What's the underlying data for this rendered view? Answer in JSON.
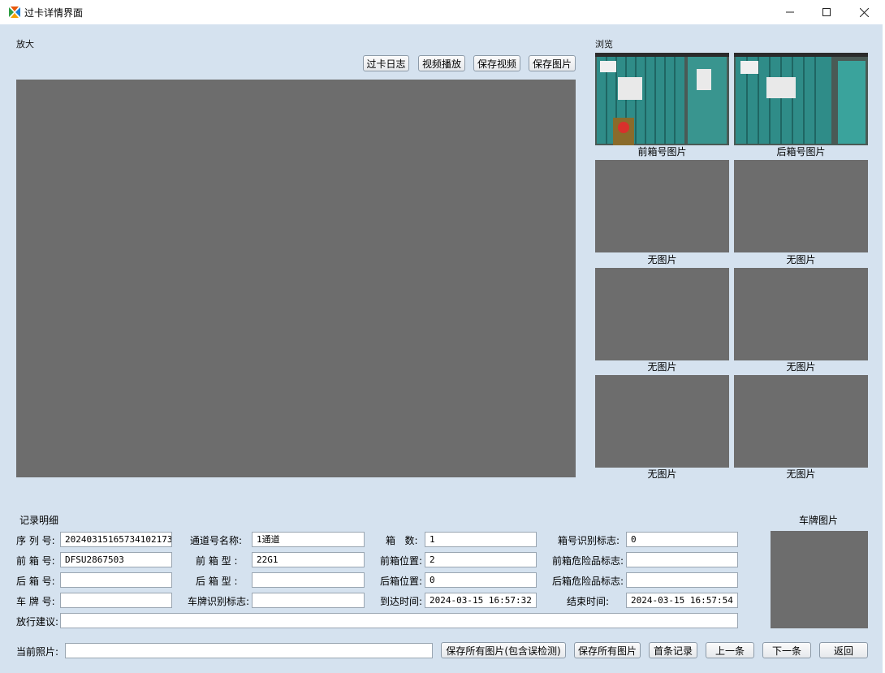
{
  "window": {
    "title": "过卡详情界面"
  },
  "zoom_section": {
    "label": "放大"
  },
  "browse_section": {
    "label": "浏览"
  },
  "toolbar": {
    "log_label": "过卡日志",
    "play_label": "视频播放",
    "save_video_label": "保存视频",
    "save_image_label": "保存图片"
  },
  "thumbnails": [
    {
      "caption": "前箱号图片"
    },
    {
      "caption": "后箱号图片"
    },
    {
      "caption": "无图片"
    },
    {
      "caption": "无图片"
    },
    {
      "caption": "无图片"
    },
    {
      "caption": "无图片"
    },
    {
      "caption": "无图片"
    },
    {
      "caption": "无图片"
    }
  ],
  "details": {
    "section_label": "记录明细",
    "plate_image_label": "车牌图片",
    "fields": {
      "serial": {
        "label": "序 列 号:",
        "value": "20240315165734102173"
      },
      "channel": {
        "label": "通道号名称:",
        "value": "1通道"
      },
      "box_count": {
        "label": "箱   数:",
        "value": "1"
      },
      "box_id_flag": {
        "label": "箱号识别标志:",
        "value": "0"
      },
      "front_box_no": {
        "label": "前 箱 号:",
        "value": "DFSU2867503"
      },
      "front_box_type": {
        "label": "前 箱 型 :",
        "value": "22G1"
      },
      "front_box_pos": {
        "label": "前箱位置:",
        "value": "2"
      },
      "front_danger_flag": {
        "label": "前箱危险品标志:",
        "value": ""
      },
      "rear_box_no": {
        "label": "后 箱 号:",
        "value": ""
      },
      "rear_box_type": {
        "label": "后 箱 型 :",
        "value": ""
      },
      "rear_box_pos": {
        "label": "后箱位置:",
        "value": "0"
      },
      "rear_danger_flag": {
        "label": "后箱危险品标志:",
        "value": ""
      },
      "plate_no": {
        "label": "车 牌 号:",
        "value": ""
      },
      "plate_id_flag": {
        "label": "车牌识别标志:",
        "value": ""
      },
      "arrival_time": {
        "label": "到达时间:",
        "value": "2024-03-15 16:57:32"
      },
      "end_time": {
        "label": "结束时间:",
        "value": "2024-03-15 16:57:54"
      },
      "release_advice": {
        "label": "放行建议:",
        "value": ""
      }
    }
  },
  "bottom_bar": {
    "current_photo_label": "当前照片:",
    "current_photo_value": "",
    "save_all_with_errors": "保存所有图片(包含误检测)",
    "save_all": "保存所有图片",
    "first_record": "首条记录",
    "prev": "上一条",
    "next": "下一条",
    "back": "返回"
  }
}
